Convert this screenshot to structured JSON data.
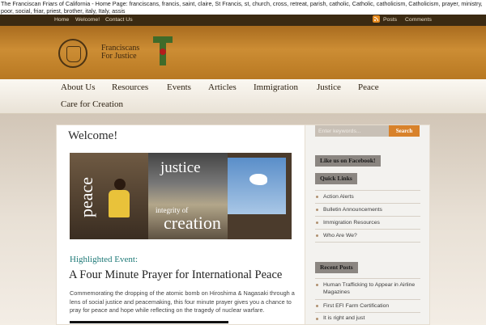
{
  "page_title": "The Franciscan Friars of California - Home Page: franciscans, francis, saint, claire, St Francis, st, church, cross, retreat, parish, catholic, Catholic, catholicism, Catholicism, prayer, ministry, poor, social, friar, priest, brother, italy, Italy, assis",
  "top_nav": {
    "home": "Home",
    "welcome": "Welcome!",
    "contact": "Contact Us",
    "posts": "Posts",
    "comments": "Comments"
  },
  "logo": {
    "line1": "Franciscans",
    "line2": "For Justice"
  },
  "main_nav": [
    "About Us",
    "Resources",
    "Events",
    "Articles",
    "Immigration",
    "Justice",
    "Peace",
    "Care for Creation"
  ],
  "content": {
    "heading": "Welcome!",
    "banner_words": {
      "peace": "peace",
      "justice": "justice",
      "integrity": "integrity of",
      "creation": "creation"
    },
    "highlight_label": "Highlighted Event:",
    "event_title": "A Four Minute Prayer for International Peace",
    "event_text": "Commemorating the dropping of the atomic bomb on Hiroshima & Nagasaki through a lens of social justice and peacemaking, this four minute prayer gives you a chance to pray for peace and hope while reflecting on the tragedy of nuclear warfare."
  },
  "sidebar": {
    "search_placeholder": "Enter keywords...",
    "search_button": "Search",
    "facebook": "Like us on Facebook!",
    "quick_links_title": "Quick Links",
    "quick_links": [
      "Action Alerts",
      "Bulletin Announcements",
      "Immigration Resources",
      "Who Are We?"
    ],
    "recent_title": "Recent Posts",
    "recent_posts": [
      "Human Trafficking to Appear in Airline Magazines",
      "First EFI Farm Certification",
      "It is right and just"
    ]
  },
  "colors": {
    "header": "#c2852e",
    "topbar": "#3b2a12",
    "accent": "#d8822b",
    "teal": "#1f7a78"
  }
}
